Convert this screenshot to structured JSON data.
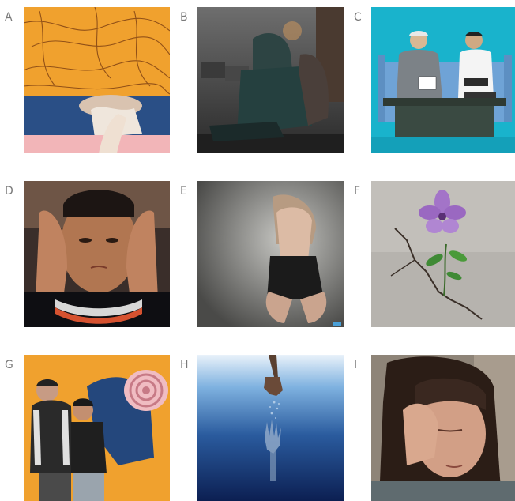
{
  "grid": {
    "labels": [
      "A",
      "B",
      "C",
      "D",
      "E",
      "F",
      "G",
      "H",
      "I"
    ]
  }
}
